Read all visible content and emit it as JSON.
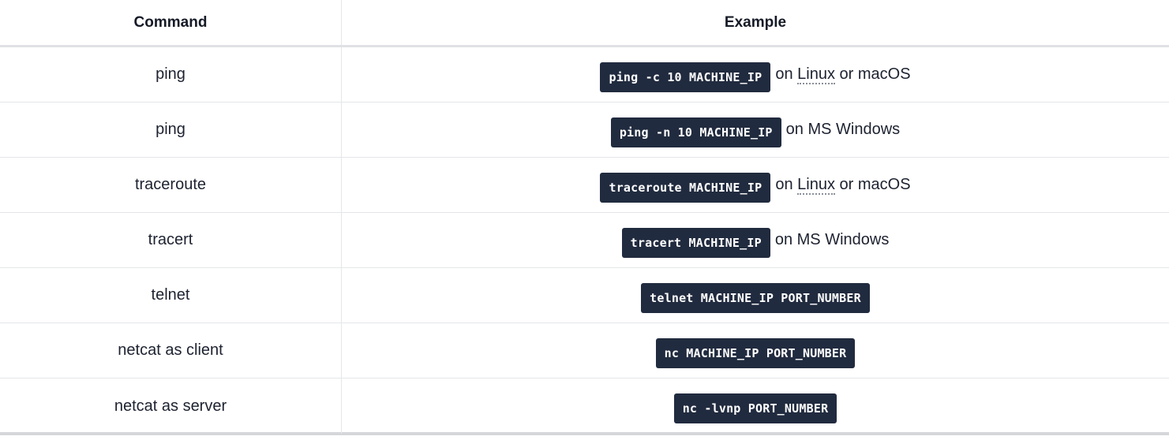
{
  "headers": {
    "command": "Command",
    "example": "Example"
  },
  "rows": [
    {
      "command": "ping",
      "code": "ping -c 10 MACHINE_IP",
      "pre": "on ",
      "os": "Linux",
      "post": " or macOS"
    },
    {
      "command": "ping",
      "code": "ping -n 10 MACHINE_IP",
      "pre": "on MS Windows",
      "os": "",
      "post": ""
    },
    {
      "command": "traceroute",
      "code": "traceroute MACHINE_IP",
      "pre": "on ",
      "os": "Linux",
      "post": " or macOS"
    },
    {
      "command": "tracert",
      "code": "tracert MACHINE_IP",
      "pre": "on MS Windows",
      "os": "",
      "post": ""
    },
    {
      "command": "telnet",
      "code": "telnet MACHINE_IP PORT_NUMBER",
      "pre": "",
      "os": "",
      "post": ""
    },
    {
      "command": "netcat as client",
      "code": "nc MACHINE_IP PORT_NUMBER",
      "pre": "",
      "os": "",
      "post": ""
    },
    {
      "command": "netcat as server",
      "code": "nc -lvnp PORT_NUMBER",
      "pre": "",
      "os": "",
      "post": ""
    }
  ]
}
